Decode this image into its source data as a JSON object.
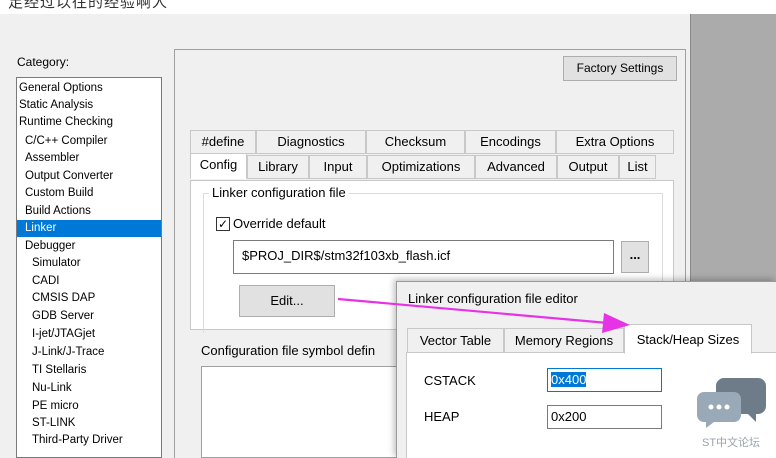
{
  "header_text": "足经过以往的经验啊人",
  "category": {
    "label": "Category:",
    "items": [
      {
        "label": "General Options",
        "indent": 0,
        "selected": false
      },
      {
        "label": "Static Analysis",
        "indent": 0,
        "selected": false
      },
      {
        "label": "Runtime Checking",
        "indent": 0,
        "selected": false
      },
      {
        "label": "C/C++ Compiler",
        "indent": 1,
        "selected": false
      },
      {
        "label": "Assembler",
        "indent": 1,
        "selected": false
      },
      {
        "label": "Output Converter",
        "indent": 1,
        "selected": false
      },
      {
        "label": "Custom Build",
        "indent": 1,
        "selected": false
      },
      {
        "label": "Build Actions",
        "indent": 1,
        "selected": false
      },
      {
        "label": "Linker",
        "indent": 1,
        "selected": true
      },
      {
        "label": "Debugger",
        "indent": 1,
        "selected": false
      },
      {
        "label": "Simulator",
        "indent": 2,
        "selected": false
      },
      {
        "label": "CADI",
        "indent": 2,
        "selected": false
      },
      {
        "label": "CMSIS DAP",
        "indent": 2,
        "selected": false
      },
      {
        "label": "GDB Server",
        "indent": 2,
        "selected": false
      },
      {
        "label": "I-jet/JTAGjet",
        "indent": 2,
        "selected": false
      },
      {
        "label": "J-Link/J-Trace",
        "indent": 2,
        "selected": false
      },
      {
        "label": "TI Stellaris",
        "indent": 2,
        "selected": false
      },
      {
        "label": "Nu-Link",
        "indent": 2,
        "selected": false
      },
      {
        "label": "PE micro",
        "indent": 2,
        "selected": false
      },
      {
        "label": "ST-LINK",
        "indent": 2,
        "selected": false
      },
      {
        "label": "Third-Party Driver",
        "indent": 2,
        "selected": false
      }
    ]
  },
  "factory_settings_label": "Factory Settings",
  "tabs_row1": [
    "#define",
    "Diagnostics",
    "Checksum",
    "Encodings",
    "Extra Options"
  ],
  "tabs_row2": [
    "Config",
    "Library",
    "Input",
    "Optimizations",
    "Advanced",
    "Output",
    "List"
  ],
  "active_tab": "Config",
  "linker_config": {
    "group_title": "Linker configuration file",
    "override_label": "Override default",
    "override_checked": true,
    "check_mark": "✓",
    "file_path": "$PROJ_DIR$/stm32f103xb_flash.icf",
    "browse_label": "...",
    "edit_label": "Edit..."
  },
  "symbol_label": "Configuration file symbol defin",
  "editor": {
    "title": "Linker configuration file editor",
    "tabs": [
      "Vector Table",
      "Memory Regions",
      "Stack/Heap Sizes"
    ],
    "active_tab": "Stack/Heap Sizes",
    "fields": [
      {
        "label": "CSTACK",
        "value": "0x400",
        "focused": true
      },
      {
        "label": "HEAP",
        "value": "0x200",
        "focused": false
      }
    ]
  },
  "watermark": {
    "text": "ST中文论坛"
  },
  "colors": {
    "selection": "#0078d7",
    "arrow": "#e633e6",
    "watermark": "#9aa3ad"
  }
}
